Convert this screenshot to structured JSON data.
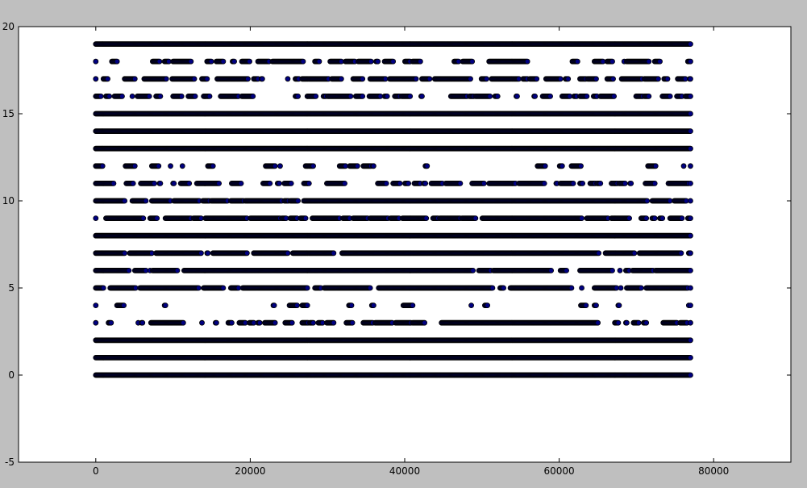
{
  "chart_data": {
    "type": "scatter",
    "title": "",
    "xlabel": "",
    "ylabel": "",
    "xlim": [
      -10000,
      90000
    ],
    "ylim": [
      -5,
      20
    ],
    "xticks": [
      0,
      20000,
      40000,
      60000,
      80000
    ],
    "yticks": [
      -5,
      0,
      5,
      10,
      15,
      20
    ],
    "xtick_labels": [
      "0",
      "20000",
      "40000",
      "60000",
      "80000"
    ],
    "ytick_labels": [
      "-5",
      "0",
      "5",
      "10",
      "15",
      "20"
    ],
    "grid": false,
    "legend": "none",
    "marker_fill": "#000080",
    "marker_edge": "#000000",
    "x_range": [
      0,
      77000
    ],
    "rows": [
      {
        "y": 0,
        "segments": [
          [
            0,
            77000
          ]
        ]
      },
      {
        "y": 1,
        "segments": [
          [
            0,
            77000
          ]
        ]
      },
      {
        "y": 2,
        "segments": [
          [
            0,
            77000
          ]
        ]
      },
      {
        "y": 3,
        "sparse": 0.45,
        "segments": [
          [
            46000,
            61500
          ]
        ]
      },
      {
        "y": 4,
        "sparse": 0.08
      },
      {
        "y": 5,
        "sparse": 0.8
      },
      {
        "y": 6,
        "sparse": 0.75,
        "segments": [
          [
            15000,
            47000
          ]
        ]
      },
      {
        "y": 7,
        "sparse": 0.75,
        "segments": [
          [
            32000,
            62000
          ]
        ]
      },
      {
        "y": 8,
        "segments": [
          [
            0,
            77000
          ]
        ]
      },
      {
        "y": 9,
        "sparse": 0.75
      },
      {
        "y": 10,
        "sparse": 0.8,
        "segments": [
          [
            30500,
            70000
          ]
        ]
      },
      {
        "y": 11,
        "sparse": 0.5
      },
      {
        "y": 12,
        "sparse": 0.15
      },
      {
        "y": 13,
        "segments": [
          [
            0,
            77000
          ]
        ]
      },
      {
        "y": 14,
        "segments": [
          [
            0,
            77000
          ]
        ]
      },
      {
        "y": 15,
        "segments": [
          [
            0,
            77000
          ]
        ]
      },
      {
        "y": 16,
        "sparse": 0.4
      },
      {
        "y": 17,
        "sparse": 0.55
      },
      {
        "y": 18,
        "sparse": 0.4
      },
      {
        "y": 19,
        "segments": [
          [
            0,
            77000
          ]
        ]
      }
    ]
  }
}
